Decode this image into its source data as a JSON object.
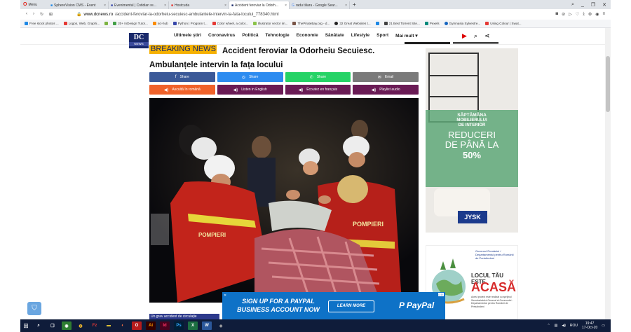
{
  "browser": {
    "menu_label": "Menu",
    "tabs": [
      {
        "label": "SphereVision CMS - Event",
        "active": false
      },
      {
        "label": "Evenimentul | Cotidian re...",
        "active": false
      },
      {
        "label": "Hostcuda",
        "active": false
      },
      {
        "label": "Accident feroviar la Odorh...",
        "active": true
      },
      {
        "label": "radu tiliaru - Google Sear...",
        "active": false
      }
    ],
    "url_domain": "www.dcnews.ro",
    "url_path": "/accident-feroviar-la-odorheiu-secuiesc-ambulantele-intervin-la-fata-locului_778340.html",
    "bookmarks": [
      {
        "label": "Free stock photos ...",
        "color": "#1e88e5"
      },
      {
        "label": "Logos, Web, Graphi...",
        "color": "#e53935"
      },
      {
        "label": "",
        "color": "#7cb342"
      },
      {
        "label": "20+ InDesign Tutor...",
        "color": "#43a047"
      },
      {
        "label": "sci-hub",
        "color": "#fb8c00"
      },
      {
        "label": "Python | Program t...",
        "color": "#3949ab"
      },
      {
        "label": "Color wheel, a color...",
        "color": "#e53935"
      },
      {
        "label": "Illustrator vector im...",
        "color": "#8bc34a"
      },
      {
        "label": "ThePirateBay.org - d...",
        "color": "#795548"
      },
      {
        "label": "32 Great Websites t...",
        "color": "#212121"
      },
      {
        "label": "",
        "color": "#1e88e5"
      },
      {
        "label": "21 Best Torrent Site...",
        "color": "#424242"
      },
      {
        "label": "Pexels",
        "color": "#00897b"
      },
      {
        "label": "Gymnasia Sylvestre...",
        "color": "#1565c0"
      },
      {
        "label": "Using Colour | Swat...",
        "color": "#e53935"
      }
    ]
  },
  "site": {
    "logo_text": "DC",
    "logo_sub": "NEWS",
    "nav": [
      "Ultimele știri",
      "Coronavirus",
      "Politică",
      "Tehnologie",
      "Economie",
      "Sănătate",
      "Lifestyle",
      "Sport",
      "Mai mult ▾"
    ]
  },
  "article": {
    "breaking_label": "BREAKING NEWS",
    "title": "Accident feroviar la Odorheiu Secuiesc. Ambulanțele intervin la fața locului",
    "share_buttons": [
      {
        "label": "Share",
        "icon": "f",
        "color": "#3b5998"
      },
      {
        "label": "Share",
        "icon": "✉",
        "color": "#2d8cf0"
      },
      {
        "label": "Share",
        "icon": "✆",
        "color": "#25d366"
      },
      {
        "label": "Email",
        "icon": "✉",
        "color": "#7a7a7a"
      }
    ],
    "audio_buttons": [
      {
        "label": "Ascultă în română",
        "icon": "◀",
        "color": "#f0622a"
      },
      {
        "label": "Listen in English",
        "icon": "◀",
        "color": "#6a1b55"
      },
      {
        "label": "Écoutez en français",
        "icon": "◀",
        "color": "#6a1b55"
      },
      {
        "label": "Playlist audio",
        "icon": "◀",
        "color": "#6a1b55"
      }
    ],
    "caption": "Un grav accident de circulație"
  },
  "ads": {
    "jysk": {
      "line1": "SĂPTĂMÂNA",
      "line2": "MOBILIERULUI",
      "line3": "DE INTERIOR",
      "line4": "REDUCERI",
      "line5": "DE PÂNĂ LA",
      "line6": "50%",
      "brand": "JYSK"
    },
    "gov": {
      "org": "Guvernul României / Departamentul pentru Românii de Pretutindeni",
      "line1": "LOCUL TĂU ESTE",
      "line2": "ACASĂ",
      "small": "Acest proiect este realizat cu sprijinul Secretariatului General al Guvernului - Departamentul pentru Românii de Pretutindeni"
    },
    "paypal": {
      "headline": "SIGN UP FOR A PAYPAL BUSINESS ACCOUNT NOW",
      "button": "LEARN MORE",
      "brand": "PayPal"
    }
  },
  "taskbar": {
    "lang": "ROU",
    "time": "19:47",
    "date": "17-Oct-20"
  }
}
